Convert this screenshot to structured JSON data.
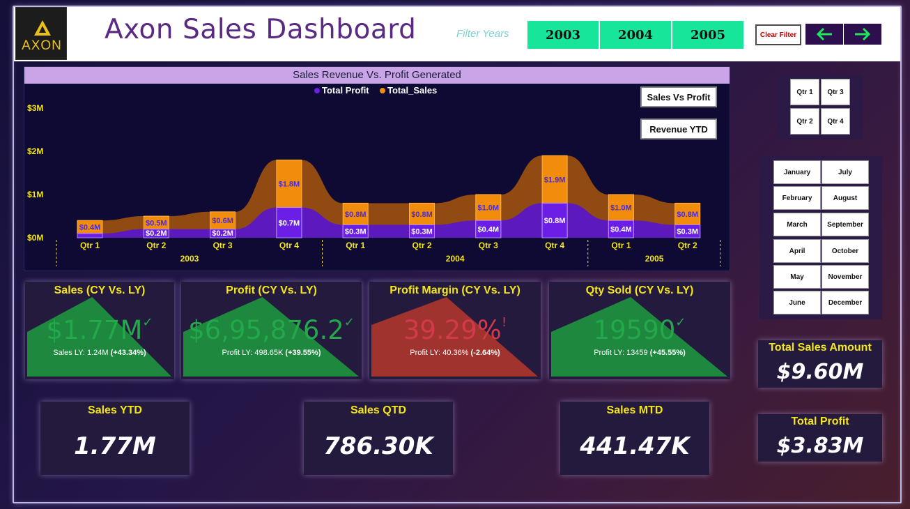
{
  "header": {
    "logo_text": "AXON",
    "title": "Axon Sales Dashboard",
    "filter_label": "Filter Years",
    "years": [
      "2003",
      "2004",
      "2005"
    ],
    "clear_filter": "Clear Filter",
    "nav_icons": [
      "arrow-left-icon",
      "arrow-right-icon"
    ],
    "accent_color": "#16e59a"
  },
  "chart": {
    "title": "Sales Revenue Vs. Profit Generated",
    "legend": [
      "Total Profit",
      "Total_Sales"
    ],
    "buttons": [
      "Sales Vs Profit",
      "Revenue YTD"
    ]
  },
  "chart_data": {
    "type": "bar",
    "title": "Sales Revenue Vs. Profit Generated",
    "categories": [
      "Qtr 1",
      "Qtr 2",
      "Qtr 3",
      "Qtr 4",
      "Qtr 1",
      "Qtr 2",
      "Qtr 3",
      "Qtr 4",
      "Qtr 1",
      "Qtr 2"
    ],
    "groups": [
      {
        "label": "2003",
        "count": 4
      },
      {
        "label": "2004",
        "count": 4
      },
      {
        "label": "2005",
        "count": 2
      }
    ],
    "series": [
      {
        "name": "Total Profit",
        "color": "#6a1ee6",
        "values": [
          0.1,
          0.2,
          0.2,
          0.7,
          0.3,
          0.3,
          0.4,
          0.8,
          0.4,
          0.3
        ],
        "labels": [
          "",
          "$0.2M",
          "$0.2M",
          "$0.7M",
          "$0.3M",
          "$0.3M",
          "$0.4M",
          "$0.8M",
          "$0.4M",
          "$0.3M"
        ]
      },
      {
        "name": "Total_Sales",
        "color": "#f28c0c",
        "values": [
          0.4,
          0.5,
          0.6,
          1.8,
          0.8,
          0.8,
          1.0,
          1.9,
          1.0,
          0.8
        ],
        "labels": [
          "$0.4M",
          "$0.5M",
          "$0.6M",
          "$1.8M",
          "$0.8M",
          "$0.8M",
          "$1.0M",
          "$1.9M",
          "$1.0M",
          "$0.8M"
        ]
      }
    ],
    "ylim": [
      0,
      3
    ],
    "y_ticks": [
      "$0M",
      "$1M",
      "$2M",
      "$3M"
    ],
    "legend_placement": "top-center",
    "grid": false
  },
  "kpi_cards": [
    {
      "title": "Sales (CY Vs. LY)",
      "value": "$1.77M",
      "mark": "✓",
      "sub_prefix": "Sales LY: 1.24M",
      "sub_delta": "(+43.34%)",
      "status": "good"
    },
    {
      "title": "Profit (CY Vs. LY)",
      "value": "$6,95,876.2",
      "mark": "✓",
      "sub_prefix": "Profit LY: 498.65K",
      "sub_delta": "(+39.55%)",
      "status": "good"
    },
    {
      "title": "Profit Margin (CY Vs. LY)",
      "value": "39.29%",
      "mark": "!",
      "sub_prefix": "Profit LY: 40.36%",
      "sub_delta": "(-2.64%)",
      "status": "bad"
    },
    {
      "title": "Qty Sold (CY Vs. LY)",
      "value": "19590",
      "mark": "✓",
      "sub_prefix": "Profit LY: 13459",
      "sub_delta": "(+45.55%)",
      "status": "good"
    }
  ],
  "status_colors": {
    "good": "#1e8e3e",
    "bad": "#c0392b"
  },
  "period_cards": [
    {
      "title": "Sales YTD",
      "value": "1.77M"
    },
    {
      "title": "Sales QTD",
      "value": "786.30K"
    },
    {
      "title": "Sales MTD",
      "value": "441.47K"
    }
  ],
  "totals": [
    {
      "title": "Total Sales Amount",
      "value": "$9.60M"
    },
    {
      "title": "Total Profit",
      "value": "$3.83M"
    }
  ],
  "quarters": [
    "Qtr 1",
    "Qtr 3",
    "Qtr 2",
    "Qtr 4"
  ],
  "months": [
    [
      "January",
      "July"
    ],
    [
      "February",
      "August"
    ],
    [
      "March",
      "September"
    ],
    [
      "April",
      "October"
    ],
    [
      "May",
      "November"
    ],
    [
      "June",
      "December"
    ]
  ]
}
